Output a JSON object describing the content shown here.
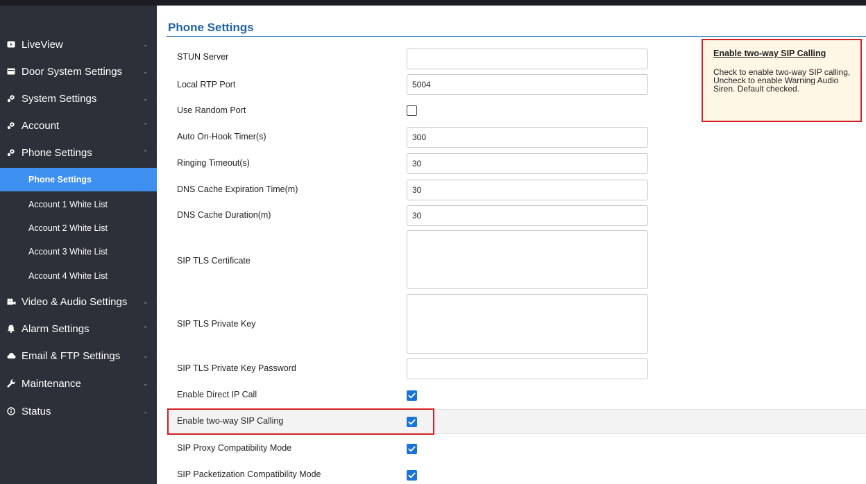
{
  "sidebar": {
    "items": [
      {
        "label": "LiveView",
        "icon": "monitor-icon"
      },
      {
        "label": "Door System Settings",
        "icon": "door-panel-icon"
      },
      {
        "label": "System Settings",
        "icon": "gear-icon"
      },
      {
        "label": "Account",
        "icon": "gear-icon"
      },
      {
        "label": "Phone Settings",
        "icon": "gear-icon"
      },
      {
        "label": "Video & Audio Settings",
        "icon": "video-camera-icon"
      },
      {
        "label": "Alarm Settings",
        "icon": "bell-icon"
      },
      {
        "label": "Email & FTP Settings",
        "icon": "cloud-icon"
      },
      {
        "label": "Maintenance",
        "icon": "wrench-icon"
      },
      {
        "label": "Status",
        "icon": "info-icon"
      }
    ],
    "sub_items": [
      {
        "label": "Phone Settings",
        "active": true
      },
      {
        "label": "Account 1 White List",
        "active": false
      },
      {
        "label": "Account 2 White List",
        "active": false
      },
      {
        "label": "Account 3 White List",
        "active": false
      },
      {
        "label": "Account 4 White List",
        "active": false
      }
    ],
    "colors": {
      "background": "#2c3038",
      "active": "#3d8ff0"
    }
  },
  "main": {
    "title": "Phone Settings",
    "fields": {
      "stun_server": {
        "label": "STUN Server",
        "value": ""
      },
      "local_rtp_port": {
        "label": "Local RTP Port",
        "value": "5004"
      },
      "use_random_port": {
        "label": "Use Random Port",
        "checked": false
      },
      "auto_on_hook_timer": {
        "label": "Auto On-Hook Timer(s)",
        "value": "300"
      },
      "ringing_timeout": {
        "label": "Ringing Timeout(s)",
        "value": "30"
      },
      "dns_cache_expiration": {
        "label": "DNS Cache Expiration Time(m)",
        "value": "30"
      },
      "dns_cache_duration": {
        "label": "DNS Cache Duration(m)",
        "value": "30"
      },
      "sip_tls_certificate": {
        "label": "SIP TLS Certificate",
        "value": ""
      },
      "sip_tls_private_key": {
        "label": "SIP TLS Private Key",
        "value": ""
      },
      "sip_tls_private_key_password": {
        "label": "SIP TLS Private Key Password",
        "value": ""
      },
      "enable_direct_ip_call": {
        "label": "Enable Direct IP Call",
        "checked": true
      },
      "enable_two_way_sip_calling": {
        "label": "Enable two-way SIP Calling",
        "checked": true
      },
      "sip_proxy_compatibility_mode": {
        "label": "SIP Proxy Compatibility Mode",
        "checked": true
      },
      "sip_packetization_compatibility_mode": {
        "label": "SIP Packetization Compatibility Mode",
        "checked": true
      }
    }
  },
  "tooltip": {
    "title": "Enable two-way SIP Calling",
    "body": "Check to enable two-way SIP calling, Uncheck to enable Warning Audio Siren. Default checked."
  },
  "colors": {
    "accent": "#1f62a6",
    "checkbox": "#1a73d9",
    "highlight_border": "#d71f26",
    "tooltip_bg": "#fff7e6"
  }
}
